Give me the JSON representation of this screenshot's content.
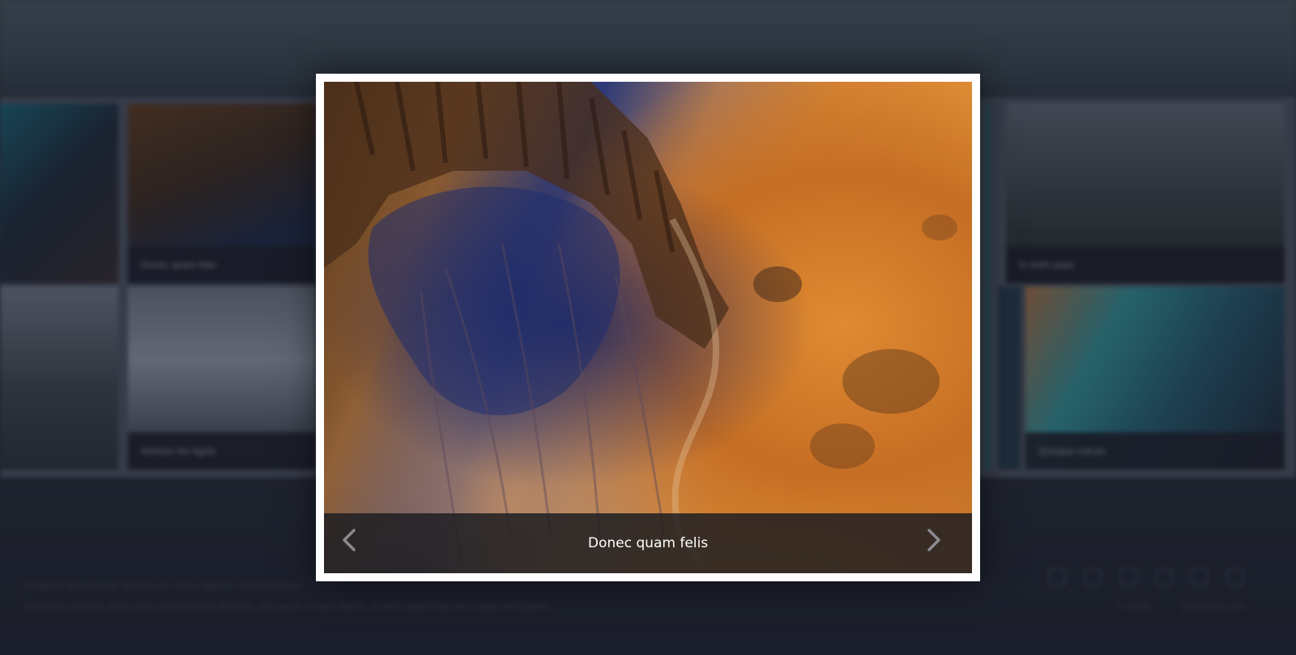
{
  "background": {
    "gallery_tiles": [
      {
        "caption": "Donec quam felis"
      },
      {
        "caption": "In enim justo"
      },
      {
        "caption": "Aenean leo ligula"
      },
      {
        "caption": "Quisque rutrum"
      }
    ],
    "footer": {
      "line1": "Curabitur ullamcorper ultricies nisi. Nam eget dui. Etiam rhoncus.",
      "line2": "Maecenas tempus, tellus eget condimentum rhoncus, sem quam semper libero, sit amet adipiscing sem neque sed ipsum.",
      "copyright": "© PIXEL",
      "credit": "By Deluxe WS",
      "social_icons": [
        "twitter-icon",
        "instagram-icon",
        "facebook-icon",
        "dribbble-icon",
        "pinterest-icon",
        "email-icon"
      ]
    }
  },
  "lightbox": {
    "caption": "Donec quam felis",
    "prev_icon": "chevron-left-icon",
    "next_icon": "chevron-right-icon",
    "colors": {
      "frame": "#ffffff",
      "caption_bar": "#1e1e22",
      "arrow": "#8a8a8f"
    }
  }
}
